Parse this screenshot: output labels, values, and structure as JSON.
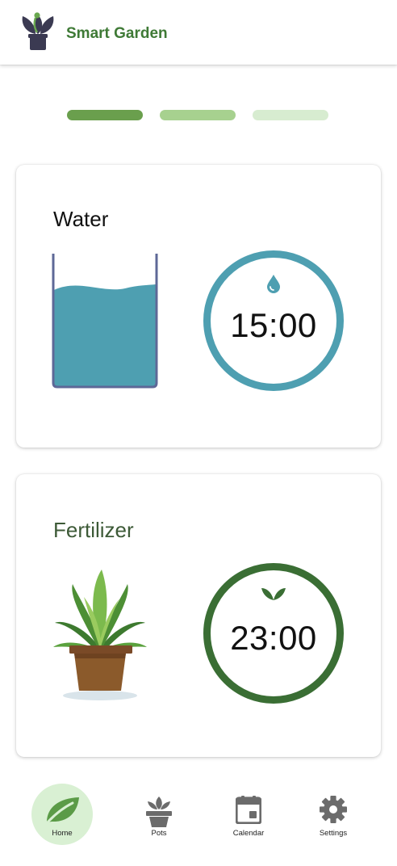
{
  "app": {
    "title": "Smart Garden",
    "logo_icon": "potted-plant-logo-icon"
  },
  "progress": {
    "steps": 3,
    "colors": [
      "#6a9f4d",
      "#a7d18f",
      "#d7ecd0"
    ]
  },
  "water": {
    "title": "Water",
    "timer": "15:00",
    "level": 0.75,
    "accent": "#4e9fb1",
    "icon": "water-drop-icon"
  },
  "fertilizer": {
    "title": "Fertilizer",
    "timer": "23:00",
    "accent": "#3a6e34",
    "icon": "sprout-icon"
  },
  "colors": {
    "title_text": "#3f7a36",
    "water_title": "#111111",
    "fert_title": "#3d5a37",
    "nav_icon": "#6b6b6b",
    "nav_active_bg": "#d9f0d3"
  },
  "nav": {
    "items": [
      {
        "label": "Home",
        "icon": "leaf-icon",
        "active": true
      },
      {
        "label": "Pots",
        "icon": "pot-icon",
        "active": false
      },
      {
        "label": "Calendar",
        "icon": "calendar-icon",
        "active": false
      },
      {
        "label": "Settings",
        "icon": "gear-icon",
        "active": false
      }
    ]
  }
}
